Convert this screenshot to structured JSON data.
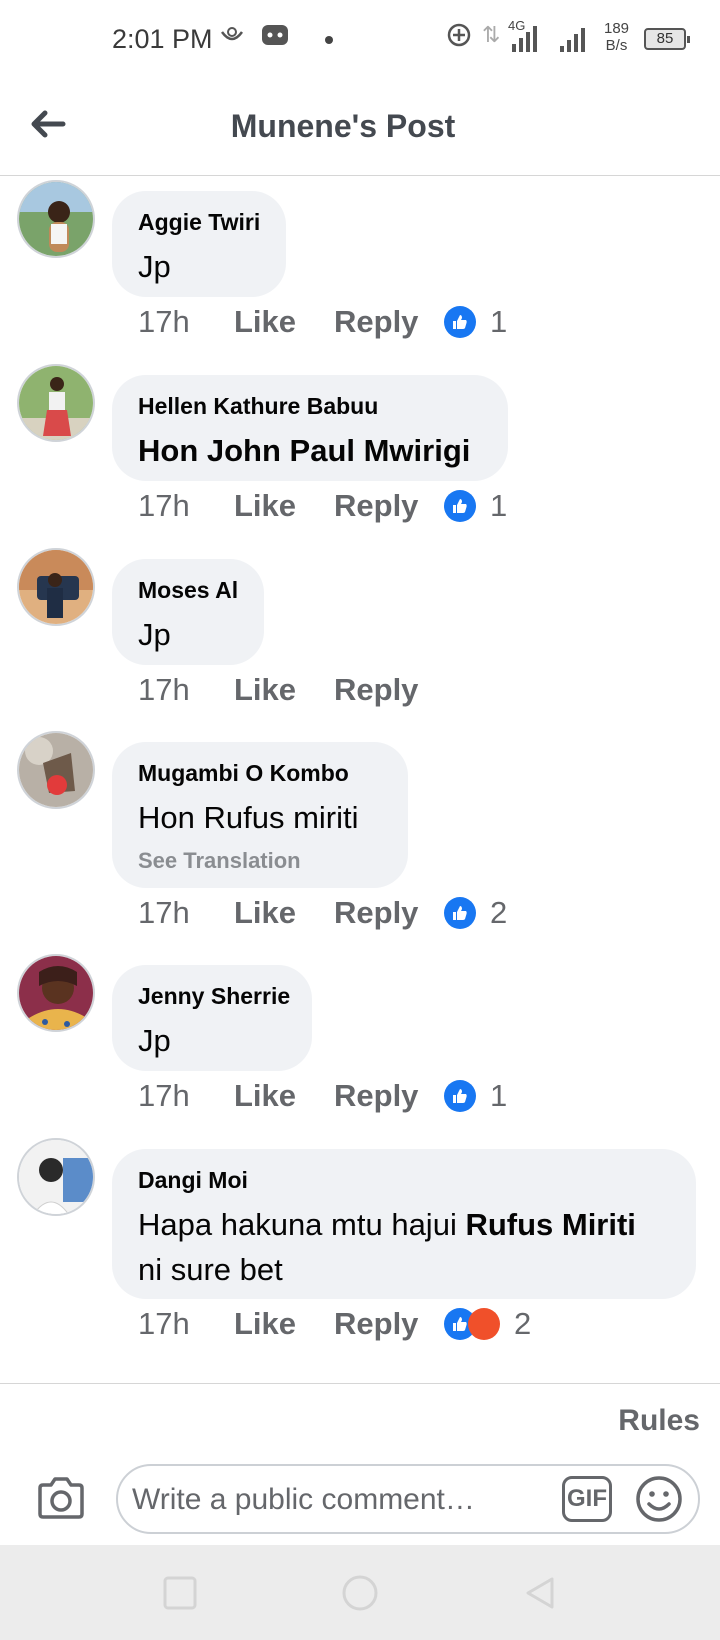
{
  "status_bar": {
    "time": "2:01 PM",
    "network_type": "4G",
    "speed_value": "189",
    "speed_unit": "B/s",
    "battery": "85"
  },
  "header": {
    "title": "Munene's Post"
  },
  "comments": [
    {
      "author": "Aggie Twiri",
      "text": "Jp",
      "time": "17h",
      "like_label": "Like",
      "reply_label": "Reply",
      "reaction_count": "1",
      "avatar_colors": [
        "#7aa36a",
        "#c08a5a",
        "#2e4a2e"
      ]
    },
    {
      "author": "Hellen Kathure Babuu",
      "text": "Hon John Paul Mwirigi",
      "time": "17h",
      "like_label": "Like",
      "reply_label": "Reply",
      "reaction_count": "1",
      "avatar_colors": [
        "#8fb36f",
        "#d94a4a",
        "#4c6b3a"
      ]
    },
    {
      "author": "Moses Al",
      "text": "Jp",
      "time": "17h",
      "like_label": "Like",
      "reply_label": "Reply",
      "reaction_count": "",
      "avatar_colors": [
        "#c98a5a",
        "#26364f",
        "#e0b080"
      ]
    },
    {
      "author": "Mugambi O Kombo",
      "text": "Hon Rufus miriti",
      "see_translation": "See Translation",
      "time": "17h",
      "like_label": "Like",
      "reply_label": "Reply",
      "reaction_count": "2",
      "avatar_colors": [
        "#b8b0a6",
        "#e23b3b",
        "#6e5a4a"
      ]
    },
    {
      "author": "Jenny Sherrie",
      "text": "Jp",
      "time": "17h",
      "like_label": "Like",
      "reply_label": "Reply",
      "reaction_count": "1",
      "avatar_colors": [
        "#8c2f4a",
        "#e9b44c",
        "#3c1f1a"
      ]
    },
    {
      "author": "Dangi Moi",
      "text_part1": "Hapa hakuna mtu hajui ",
      "text_bold": "Rufus Miriti",
      "text_line2": "ni sure bet",
      "time": "17h",
      "like_label": "Like",
      "reply_label": "Reply",
      "reaction_count": "2",
      "avatar_colors": [
        "#f2f2f2",
        "#2a2a2a",
        "#5b8cc9"
      ]
    }
  ],
  "composer": {
    "rules_label": "Rules",
    "placeholder": "Write a public comment…",
    "gif_label": "GIF"
  },
  "colors": {
    "accent_blue": "#1877f2",
    "bubble_bg": "#f0f2f5",
    "muted_text": "#65676b"
  }
}
